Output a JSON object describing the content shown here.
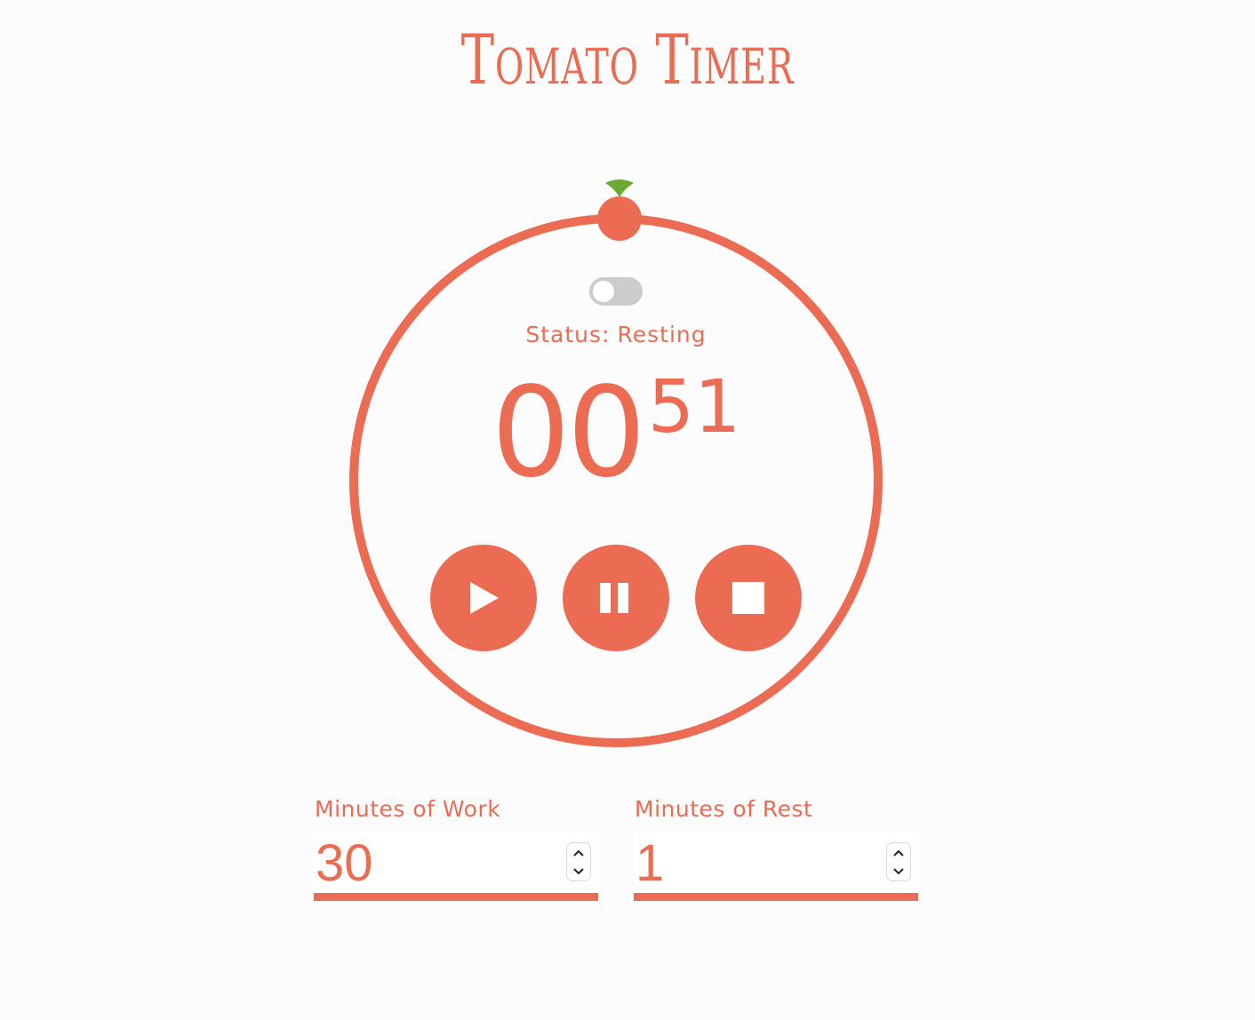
{
  "app": {
    "title": "Tomato Timer"
  },
  "timer": {
    "status_label": "Status:",
    "status_value": "Resting",
    "minutes": "00",
    "seconds": "51",
    "mode_toggle_on": false
  },
  "controls": {
    "play_icon": "play-icon",
    "pause_icon": "pause-icon",
    "stop_icon": "stop-icon"
  },
  "settings": {
    "work": {
      "label": "Minutes of Work",
      "value": "30"
    },
    "rest": {
      "label": "Minutes of Rest",
      "value": "1"
    }
  },
  "colors": {
    "accent": "#ec6c53",
    "leaf": "#6aa832",
    "toggle_track": "#cccccc",
    "background": "#fcfcfc"
  }
}
